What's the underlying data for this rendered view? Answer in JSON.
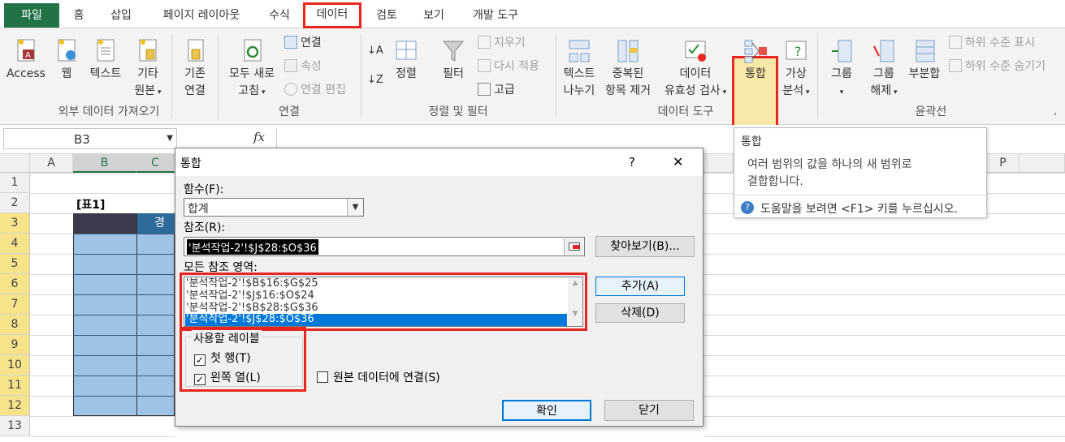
{
  "tabs": {
    "file": "파일",
    "items": [
      "홈",
      "삽입",
      "페이지 레이아웃",
      "수식",
      "데이터",
      "검토",
      "보기",
      "개발 도구"
    ]
  },
  "ribbon": {
    "access": "Access",
    "web": "웹",
    "text": "텍스트",
    "other_line1": "기타",
    "other_line2": "원본",
    "existing_line1": "기존",
    "existing_line2": "연결",
    "refresh_line1": "모두 새로",
    "refresh_line2": "고침",
    "connections": "연결",
    "properties": "속성",
    "edit_links": "연결 편집",
    "sort": "정렬",
    "filter": "필터",
    "clear": "지우기",
    "reapply": "다시 적용",
    "advanced": "고급",
    "text_split_line1": "텍스트",
    "text_split_line2": "나누기",
    "remove_dup_line1": "중복된",
    "remove_dup_line2": "항목 제거",
    "validation_line1": "데이터",
    "validation_line2": "유효성 검사",
    "consolidate": "통합",
    "whatif_line1": "가상",
    "whatif_line2": "분석",
    "group": "그룹",
    "ungroup_line1": "그룹",
    "ungroup_line2": "해제",
    "subtotal": "부분합",
    "show_detail": "하위 수준 표시",
    "hide_detail": "하위 수준 숨기기",
    "group_get_external": "외부 데이터 가져오기",
    "group_connections": "연결",
    "group_sort_filter": "정렬 및 필터",
    "group_data_tools": "데이터 도구",
    "group_outline": "윤곽선"
  },
  "formula_bar": {
    "name_box": "B3",
    "fx": "fx",
    "value": ""
  },
  "grid": {
    "columns": [
      "A",
      "B",
      "C",
      "P"
    ],
    "rows": [
      "1",
      "2",
      "3",
      "4",
      "5",
      "6",
      "7",
      "8",
      "9",
      "10",
      "11",
      "12",
      "13"
    ],
    "b2": "[표1]",
    "c3": "경기"
  },
  "dialog": {
    "title": "통합",
    "help": "?",
    "close": "✕",
    "function_label": "함수(F):",
    "function_value": "합계",
    "reference_label": "참조(R):",
    "reference_value": "'분석작업-2'!$J$28:$O$36",
    "browse_button": "찾아보기(B)...",
    "all_refs_label": "모든 참조 영역:",
    "refs": [
      "'분석작업-2'!$B$16:$G$25",
      "'분석작업-2'!$J$16:$O$24",
      "'분석작업-2'!$B$28:$G$36",
      "'분석작업-2'!$J$28:$O$36"
    ],
    "add_button": "추가(A)",
    "delete_button": "삭제(D)",
    "use_labels": "사용할 레이블",
    "top_row": "첫 행(T)",
    "left_column": "왼쪽 열(L)",
    "link_source": "원본 데이터에 연결(S)",
    "ok_button": "확인",
    "close_button": "닫기"
  },
  "tooltip": {
    "title": "통합",
    "body_line1": "여러 범위의 값을 하나의 새 범위로",
    "body_line2": "결합합니다.",
    "help": "도움말을 보려면 <F1> 키를 누르십시오."
  },
  "colors": {
    "excel_green": "#217346",
    "highlight_red": "#e8261f",
    "selection_blue": "#0078d7",
    "table_blue": "#9dc3e6",
    "table_header": "#3a3a4a"
  }
}
